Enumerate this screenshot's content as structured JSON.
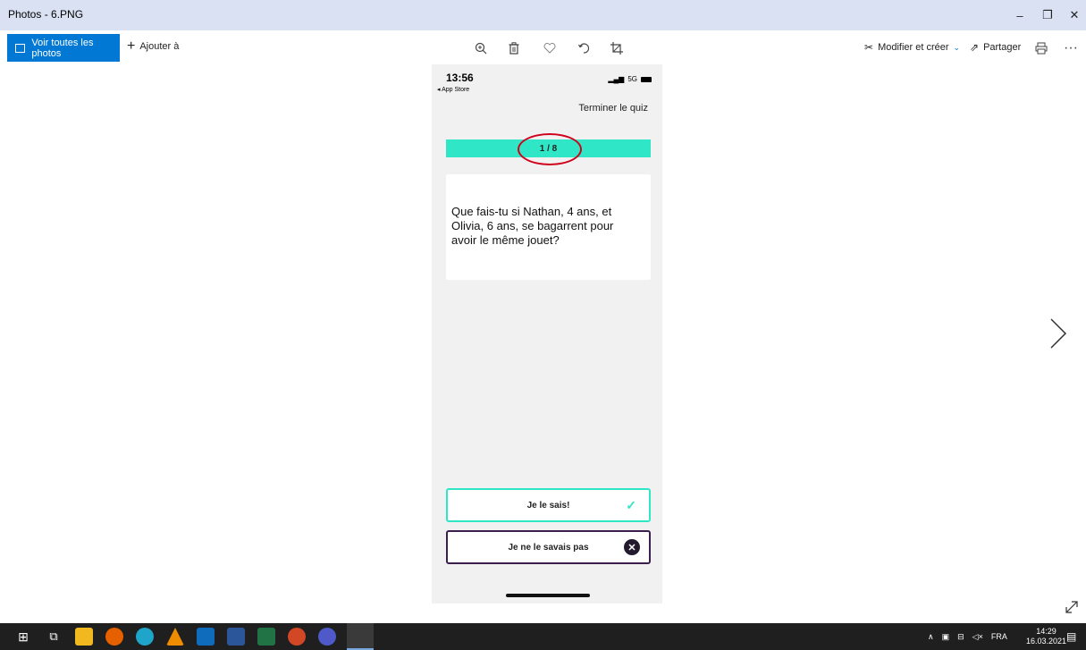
{
  "window": {
    "title": "Photos - 6.PNG",
    "minimize": "–",
    "restore": "❐",
    "close": "✕"
  },
  "toolbar": {
    "view_all": "Voir toutes les photos",
    "add_to": "Ajouter à",
    "edit_create": "Modifier et créer",
    "share": "Partager",
    "more": "···"
  },
  "phone": {
    "time": "13:56",
    "back_app": "◂ App Store",
    "network": "5G",
    "quit_label": "Terminer le quiz",
    "progress": "1 / 8",
    "question": "Que fais-tu si Nathan, 4 ans, et Olivia, 6 ans, se bagarrent pour avoir le même jouet?",
    "know_label": "Je le sais!",
    "dont_know_label": "Je ne le savais pas"
  },
  "taskbar": {
    "language": "FRA",
    "time": "14:29",
    "date": "16.03.2021"
  },
  "colors": {
    "accent": "#0078d4",
    "quiz_teal": "#2fe6c6",
    "quiz_purple": "#3c1f4f",
    "annotation_red": "#d0021b"
  }
}
